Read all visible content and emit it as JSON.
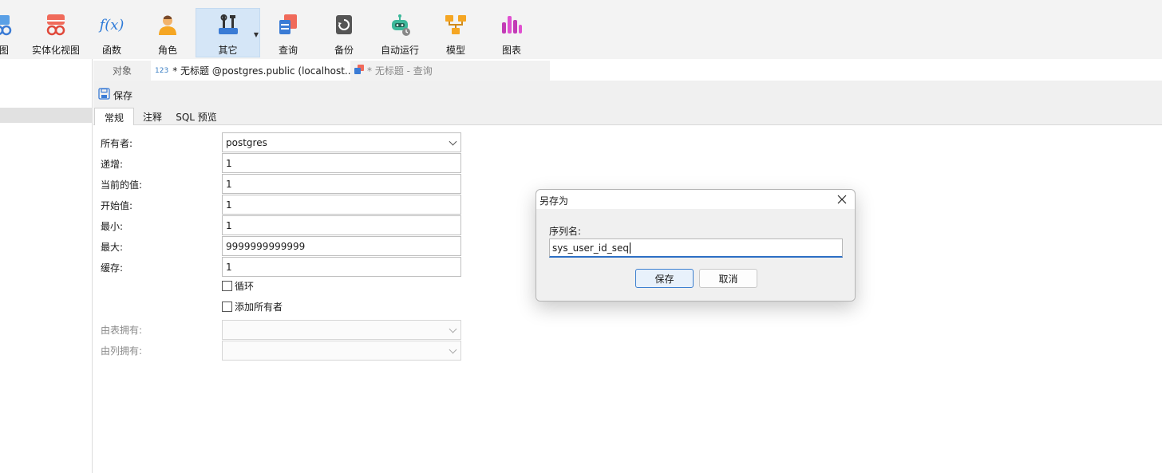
{
  "toolbar": {
    "items": [
      {
        "label": "图",
        "icon": "view-icon"
      },
      {
        "label": "实体化视图",
        "icon": "materialized-view-icon"
      },
      {
        "label": "函数",
        "icon": "function-icon"
      },
      {
        "label": "角色",
        "icon": "user-role-icon"
      },
      {
        "label": "其它",
        "icon": "tools-icon"
      },
      {
        "label": "查询",
        "icon": "query-icon"
      },
      {
        "label": "备份",
        "icon": "backup-icon"
      },
      {
        "label": "自动运行",
        "icon": "robot-icon"
      },
      {
        "label": "模型",
        "icon": "model-icon"
      },
      {
        "label": "图表",
        "icon": "chart-icon"
      }
    ],
    "function_glyph": "f(x)"
  },
  "tabs": {
    "objects": "对象",
    "sequence_prefix": "123",
    "sequence": "* 无标题 @postgres.public (localhost...",
    "query": "* 无标题 - 查询"
  },
  "subtoolbar": {
    "save_label": "保存"
  },
  "inner_tabs": {
    "general": "常规",
    "comment": "注释",
    "sql_preview": "SQL 预览"
  },
  "form": {
    "owner_label": "所有者:",
    "owner_value": "postgres",
    "increment_label": "递增:",
    "increment_value": "1",
    "current_label": "当前的值:",
    "current_value": "1",
    "start_label": "开始值:",
    "start_value": "1",
    "min_label": "最小:",
    "min_value": "1",
    "max_label": "最大:",
    "max_value": "9999999999999",
    "cache_label": "缓存:",
    "cache_value": "1",
    "cycle_label": "循环",
    "add_owner_label": "添加所有者",
    "owned_by_table_label": "由表拥有:",
    "owned_by_column_label": "由列拥有:"
  },
  "dialog": {
    "title": "另存为",
    "field_label": "序列名:",
    "field_value": "sys_user_id_seq",
    "ok_label": "保存",
    "cancel_label": "取消"
  },
  "colors": {
    "accent": "#2c6fc4",
    "active_tab_bg": "#d5e6f7"
  }
}
